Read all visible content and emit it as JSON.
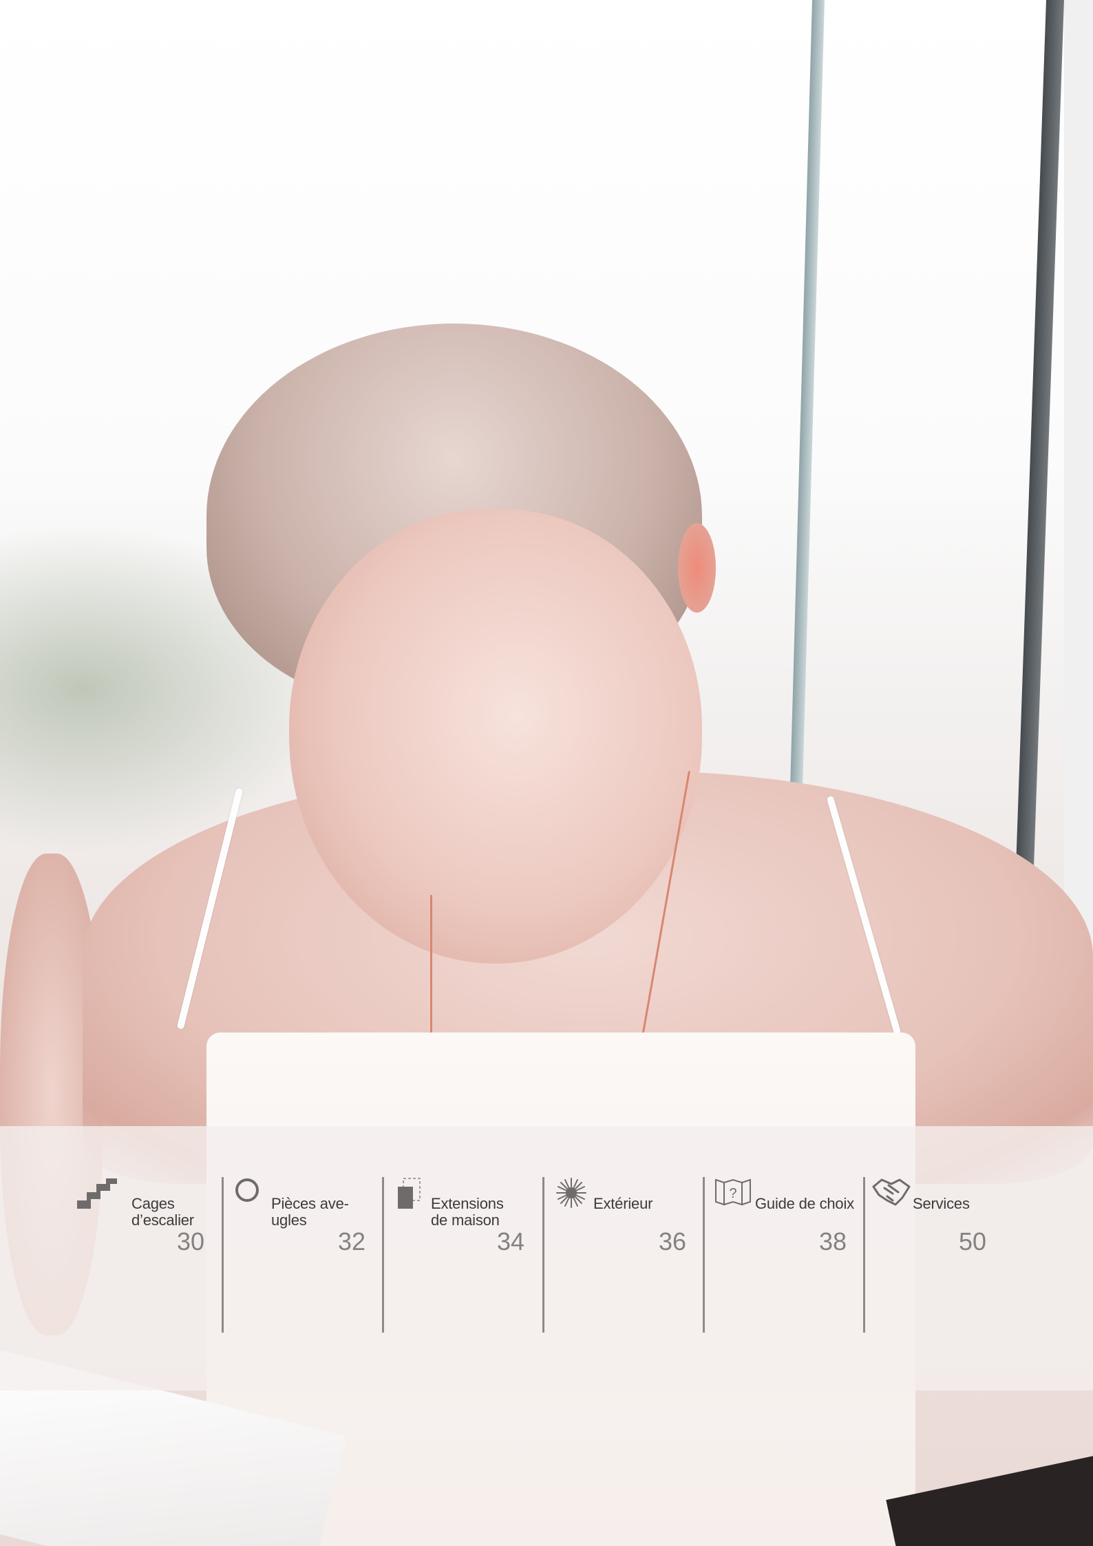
{
  "toc": {
    "items": [
      {
        "id": "stairs",
        "icon": "stairs-icon",
        "label_line1": "Cages",
        "label_line2": "d’escalier",
        "page": "30"
      },
      {
        "id": "blind-rooms",
        "icon": "circle-icon",
        "label_line1": "Pièces ave-",
        "label_line2": "ugles",
        "page": "32"
      },
      {
        "id": "extensions",
        "icon": "extension-icon",
        "label_line1": "Extensions",
        "label_line2": "de maison",
        "page": "34"
      },
      {
        "id": "exterior",
        "icon": "sun-icon",
        "label_line1": "Extérieur",
        "label_line2": "",
        "page": "36"
      },
      {
        "id": "guide",
        "icon": "guide-book-icon",
        "label_line1": "Guide de choix",
        "label_line2": "",
        "page": "38"
      },
      {
        "id": "services",
        "icon": "handshake-icon",
        "label_line1": "Services",
        "label_line2": "",
        "page": "50"
      }
    ],
    "colors": {
      "icon": "#6f6b6b",
      "text": "#3d3a3a",
      "page_number": "#858181",
      "band": "#f4efee"
    }
  }
}
